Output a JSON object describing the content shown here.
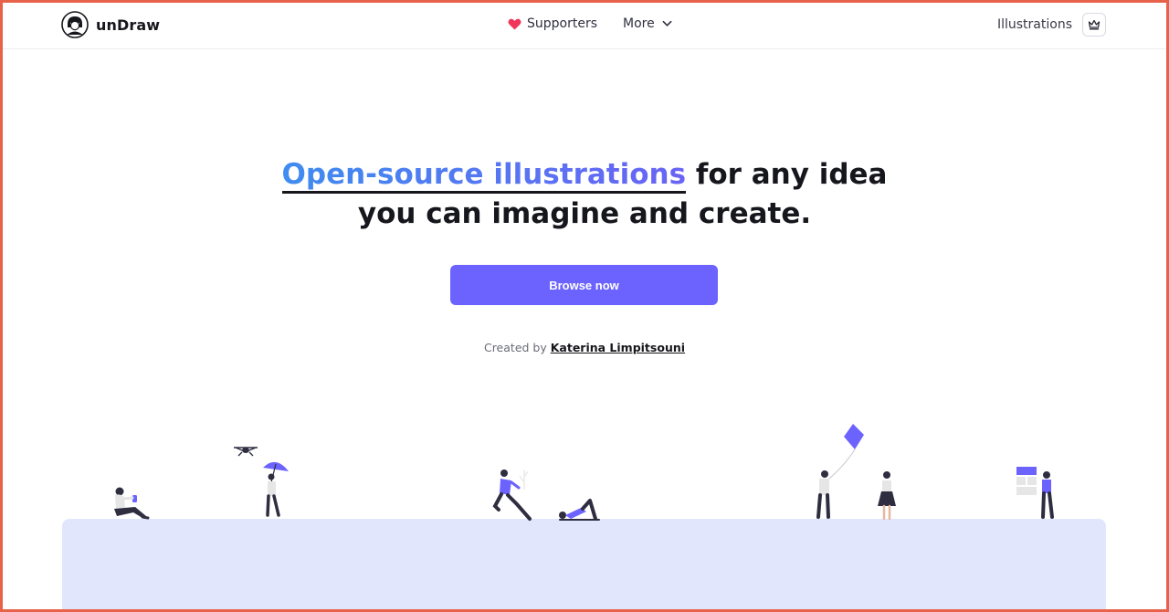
{
  "brand": {
    "name": "unDraw",
    "logo_icon": "undraw-avatar-logo-icon"
  },
  "nav": {
    "supporters_label": "Supporters",
    "supporters_icon": "heart-icon",
    "more_label": "More",
    "more_icon": "chevron-down-icon"
  },
  "right_nav": {
    "illustrations_label": "Illustrations",
    "crown_icon": "crown-icon"
  },
  "hero": {
    "headline_highlight": "Open-source illustrations",
    "headline_rest_1": " for any idea",
    "headline_line_2": "you can imagine and create.",
    "cta_label": "Browse now",
    "credit_prefix": "Created by ",
    "credit_author": "Katerina Limpitsouni"
  },
  "colors": {
    "accent": "#6c63ff",
    "accent_blue": "#3f8cf0",
    "heart": "#f0365a",
    "panel_bg": "#e2e6fd",
    "text_dark": "#16161d",
    "frame_border": "#e8624a"
  }
}
